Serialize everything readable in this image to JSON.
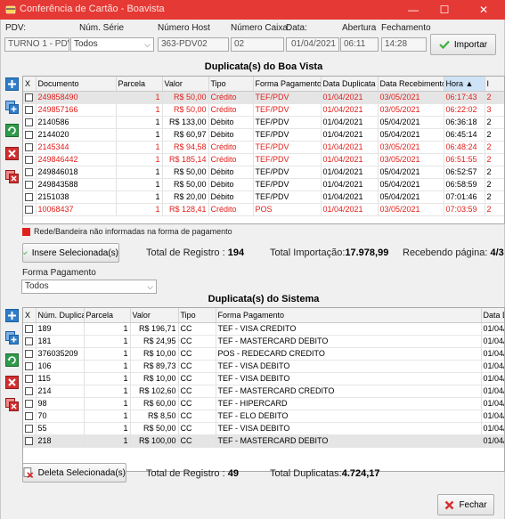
{
  "window": {
    "title": "Conferência de Cartão - Boavista",
    "minimize": "—",
    "maximize": "☐",
    "close": "✕"
  },
  "header": {
    "pdv_label": "PDV:",
    "pdv_value": "TURNO 1 - PDV2",
    "serie_label": "Núm. Série",
    "serie_value": "Todos",
    "host_label": "Número Host",
    "host_value": "363-PDV02",
    "caixa_label": "Número Caixa:",
    "caixa_value": "02",
    "data_label": "Data:",
    "data_value": "01/04/2021",
    "abertura_label": "Abertura",
    "abertura_value": "06:11",
    "fechamento_label": "Fechamento",
    "fechamento_value": "14:28",
    "importar_label": "Importar"
  },
  "boavista": {
    "title": "Duplicata(s) do Boa Vista",
    "columns": [
      "X",
      "Documento",
      "Parcela",
      "Valor",
      "Tipo",
      "Forma Pagamento",
      "Data Duplicata",
      "Data Recebimento",
      "Hora",
      "I"
    ],
    "rows": [
      {
        "doc": "249858490",
        "parcela": "1",
        "valor": "R$ 50,00",
        "tipo": "Crédito",
        "forma": "TEF/PDV",
        "data_dup": "01/04/2021",
        "data_rec": "03/05/2021",
        "hora": "06:17:43",
        "extra": "2",
        "red": true,
        "sel": true
      },
      {
        "doc": "249857166",
        "parcela": "1",
        "valor": "R$ 50,00",
        "tipo": "Crédito",
        "forma": "TEF/PDV",
        "data_dup": "01/04/2021",
        "data_rec": "03/05/2021",
        "hora": "06:22:02",
        "extra": "3",
        "red": true,
        "sel": false
      },
      {
        "doc": "2140586",
        "parcela": "1",
        "valor": "R$ 133,00",
        "tipo": "Débito",
        "forma": "TEF/PDV",
        "data_dup": "01/04/2021",
        "data_rec": "05/04/2021",
        "hora": "06:36:18",
        "extra": "2",
        "red": false,
        "sel": false
      },
      {
        "doc": "2144020",
        "parcela": "1",
        "valor": "R$ 60,97",
        "tipo": "Débito",
        "forma": "TEF/PDV",
        "data_dup": "01/04/2021",
        "data_rec": "05/04/2021",
        "hora": "06:45:14",
        "extra": "2",
        "red": false,
        "sel": false
      },
      {
        "doc": "2145344",
        "parcela": "1",
        "valor": "R$ 94,58",
        "tipo": "Crédito",
        "forma": "TEF/PDV",
        "data_dup": "01/04/2021",
        "data_rec": "03/05/2021",
        "hora": "06:48:24",
        "extra": "2",
        "red": true,
        "sel": false
      },
      {
        "doc": "249846442",
        "parcela": "1",
        "valor": "R$ 185,14",
        "tipo": "Crédito",
        "forma": "TEF/PDV",
        "data_dup": "01/04/2021",
        "data_rec": "03/05/2021",
        "hora": "06:51:55",
        "extra": "2",
        "red": true,
        "sel": false
      },
      {
        "doc": "249846018",
        "parcela": "1",
        "valor": "R$ 50,00",
        "tipo": "Débito",
        "forma": "TEF/PDV",
        "data_dup": "01/04/2021",
        "data_rec": "05/04/2021",
        "hora": "06:52:57",
        "extra": "2",
        "red": false,
        "sel": false
      },
      {
        "doc": "249843588",
        "parcela": "1",
        "valor": "R$ 50,00",
        "tipo": "Débito",
        "forma": "TEF/PDV",
        "data_dup": "01/04/2021",
        "data_rec": "05/04/2021",
        "hora": "06:58:59",
        "extra": "2",
        "red": false,
        "sel": false
      },
      {
        "doc": "2151038",
        "parcela": "1",
        "valor": "R$ 20,00",
        "tipo": "Débito",
        "forma": "TEF/PDV",
        "data_dup": "01/04/2021",
        "data_rec": "05/04/2021",
        "hora": "07:01:46",
        "extra": "2",
        "red": false,
        "sel": false
      },
      {
        "doc": "10068437",
        "parcela": "1",
        "valor": "R$ 128,41",
        "tipo": "Crédito",
        "forma": "POS",
        "data_dup": "01/04/2021",
        "data_rec": "03/05/2021",
        "hora": "07:03:59",
        "extra": "2",
        "red": true,
        "sel": false
      }
    ],
    "legend": "Rede/Bandeira não informadas na forma de pagamento",
    "insere_label": "Insere Selecionada(s)",
    "total_registro_label": "Total de Registro :",
    "total_registro_value": "194",
    "total_importacao_label": "Total Importação:",
    "total_importacao_value": "17.978,99",
    "recebendo_label": "Recebendo página:",
    "recebendo_value": "4/3"
  },
  "forma_pagamento": {
    "label": "Forma Pagamento",
    "value": "Todos"
  },
  "sistema": {
    "title": "Duplicata(s) do Sistema",
    "columns": [
      "X",
      "Núm. Duplicata",
      "Parcela",
      "Valor",
      "Tipo",
      "Forma Pagamento",
      "Data D"
    ],
    "rows": [
      {
        "num": "189",
        "parcela": "1",
        "valor": "R$ 196,71",
        "tipo": "CC",
        "forma": "TEF - VISA CREDITO",
        "data": "01/04/",
        "sel": false
      },
      {
        "num": "181",
        "parcela": "1",
        "valor": "R$ 24,95",
        "tipo": "CC",
        "forma": "TEF - MASTERCARD DEBITO",
        "data": "01/04/",
        "sel": false
      },
      {
        "num": "376035209",
        "parcela": "1",
        "valor": "R$ 10,00",
        "tipo": "CC",
        "forma": "POS - REDECARD CREDITO",
        "data": "01/04/",
        "sel": false
      },
      {
        "num": "106",
        "parcela": "1",
        "valor": "R$ 89,73",
        "tipo": "CC",
        "forma": "TEF - VISA DEBITO",
        "data": "01/04/",
        "sel": false
      },
      {
        "num": "115",
        "parcela": "1",
        "valor": "R$ 10,00",
        "tipo": "CC",
        "forma": "TEF - VISA DEBITO",
        "data": "01/04/",
        "sel": false
      },
      {
        "num": "214",
        "parcela": "1",
        "valor": "R$ 102,60",
        "tipo": "CC",
        "forma": "TEF - MASTERCARD CREDITO",
        "data": "01/04/",
        "sel": false
      },
      {
        "num": "98",
        "parcela": "1",
        "valor": "R$ 60,00",
        "tipo": "CC",
        "forma": "TEF - HIPERCARD",
        "data": "01/04/",
        "sel": false
      },
      {
        "num": "70",
        "parcela": "1",
        "valor": "R$ 8,50",
        "tipo": "CC",
        "forma": "TEF - ELO DEBITO",
        "data": "01/04/",
        "sel": false
      },
      {
        "num": "55",
        "parcela": "1",
        "valor": "R$ 50,00",
        "tipo": "CC",
        "forma": "TEF - VISA DEBITO",
        "data": "01/04/",
        "sel": false
      },
      {
        "num": "218",
        "parcela": "1",
        "valor": "R$ 100,00",
        "tipo": "CC",
        "forma": "TEF - MASTERCARD DEBITO",
        "data": "01/04/",
        "sel": true
      }
    ],
    "deleta_label": "Deleta Selecionada(s)",
    "total_registro_label": "Total de Registro :",
    "total_registro_value": "49",
    "total_duplicatas_label": "Total Duplicatas:",
    "total_duplicatas_value": "4.724,17"
  },
  "footer": {
    "fechar_label": "Fechar"
  },
  "colors": {
    "titlebar": "#e53935",
    "red_text": "#e0201b",
    "selected_header": "#cfe3f7"
  }
}
